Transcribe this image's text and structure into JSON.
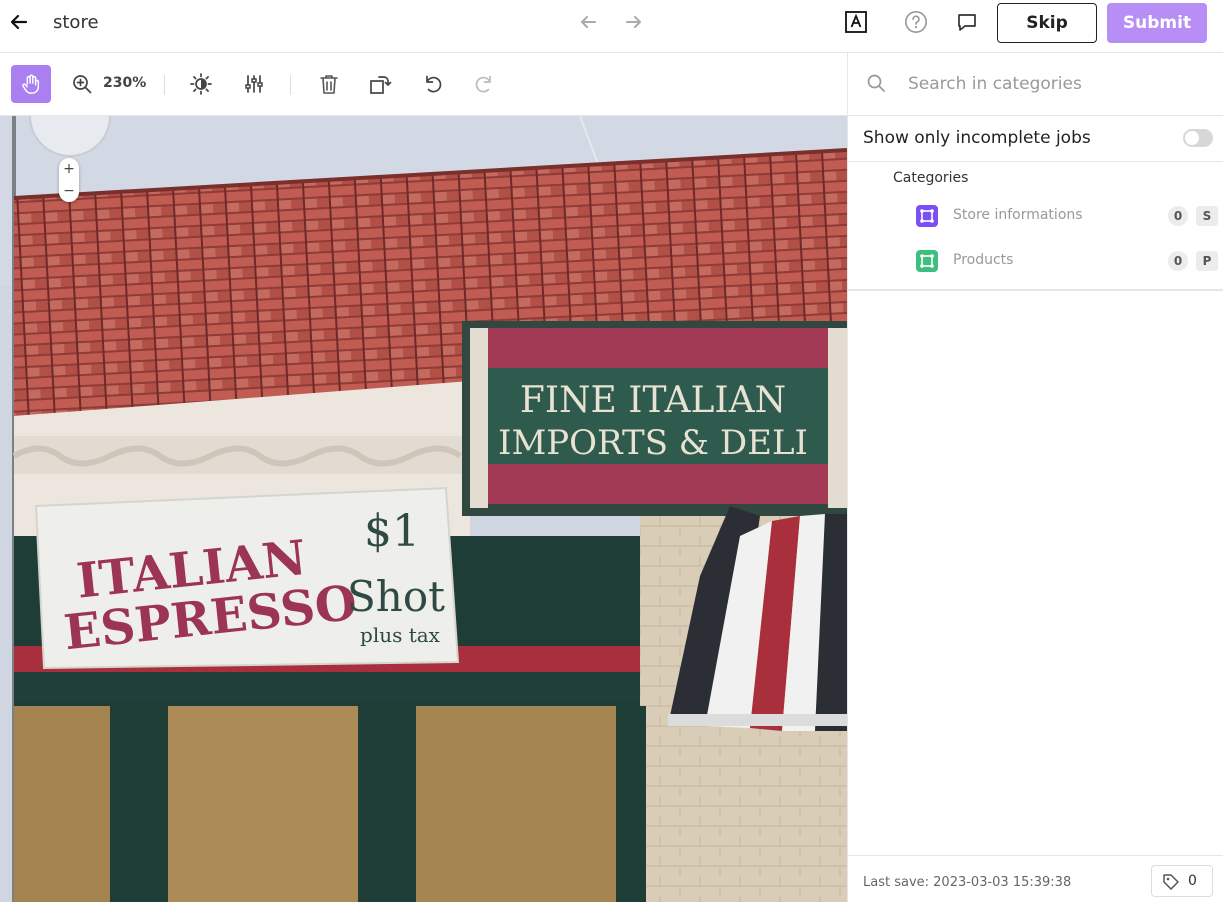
{
  "app": {
    "title": "store"
  },
  "header": {
    "skip_label": "Skip",
    "submit_label": "Submit",
    "icons": [
      "back-arrow-icon",
      "undo-nav-arrow-icon",
      "redo-nav-arrow-icon",
      "font-a-icon",
      "help-icon",
      "comment-icon"
    ]
  },
  "toolbar": {
    "zoom_level": "230%",
    "tools": [
      "hand-icon",
      "zoom-icon",
      "brightness-icon",
      "sliders-icon",
      "trash-icon",
      "rotate-icon",
      "undo-icon",
      "redo-icon"
    ]
  },
  "image": {
    "sign_fine_line1": "FINE ITALIAN",
    "sign_fine_line2": "IMPORTS & DELI",
    "sign_espresso_line1": "ITALIAN",
    "sign_espresso_line2": "ESPRESSO",
    "sign_price": "$1",
    "sign_shot": "Shot",
    "sign_tax": "plus tax",
    "map_zoom_in": "+",
    "map_zoom_out": "−"
  },
  "panel": {
    "search_placeholder": "Search in categories",
    "incomplete_label": "Show only incomplete jobs",
    "incomplete_enabled": false,
    "categories_heading": "Categories",
    "categories": [
      {
        "label": "Store informations",
        "count": "0",
        "key": "S",
        "color": "#7b4ff0"
      },
      {
        "label": "Products",
        "count": "0",
        "key": "P",
        "color": "#3fbf7f"
      }
    ],
    "last_save": "Last save: 2023-03-03 15:39:38",
    "tag_count": "0"
  },
  "colors": {
    "accent": "#b78ef5",
    "accent_active": "#a97ff2",
    "roof": "#b0504a",
    "sign_green": "#2f5a4e",
    "sign_red": "#9c3553"
  }
}
